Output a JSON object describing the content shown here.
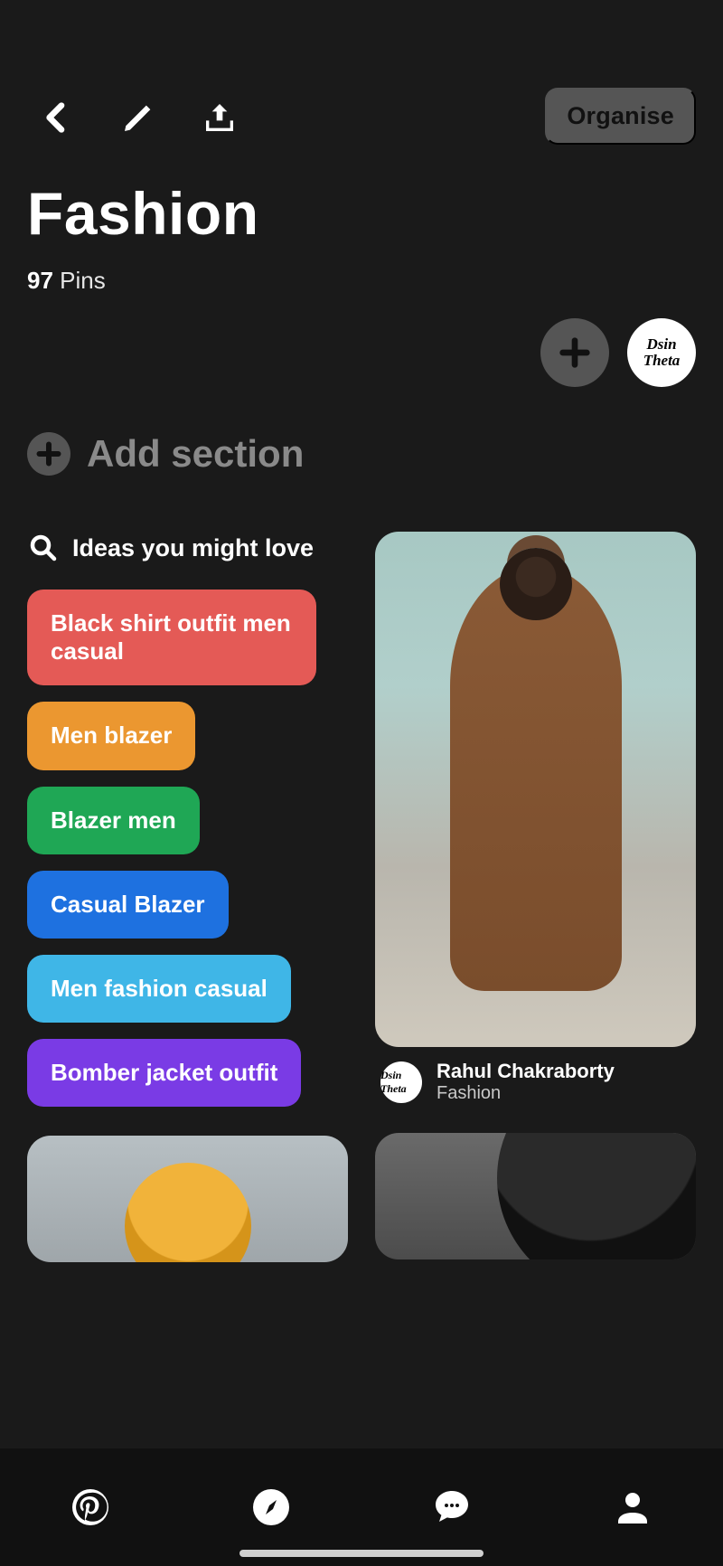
{
  "header": {
    "organise_label": "Organise"
  },
  "board": {
    "title": "Fashion",
    "pin_count": "97",
    "pin_count_suffix": "Pins",
    "avatar_name": "Dsin Theta"
  },
  "add_section": {
    "label": "Add section"
  },
  "ideas": {
    "heading": "Ideas you might love",
    "tags": [
      {
        "label": "Black shirt outfit men casual",
        "color": "#e45a56"
      },
      {
        "label": "Men blazer",
        "color": "#eb9730"
      },
      {
        "label": "Blazer men",
        "color": "#1fa755"
      },
      {
        "label": "Casual Blazer",
        "color": "#1e71e0"
      },
      {
        "label": "Men fashion casual",
        "color": "#3fb6e7"
      },
      {
        "label": "Bomber jacket outfit",
        "color": "#7a3be5"
      }
    ]
  },
  "pins": [
    {
      "author": "Rahul Chakraborty",
      "board": "Fashion",
      "avatar": "Dsin Theta"
    }
  ]
}
